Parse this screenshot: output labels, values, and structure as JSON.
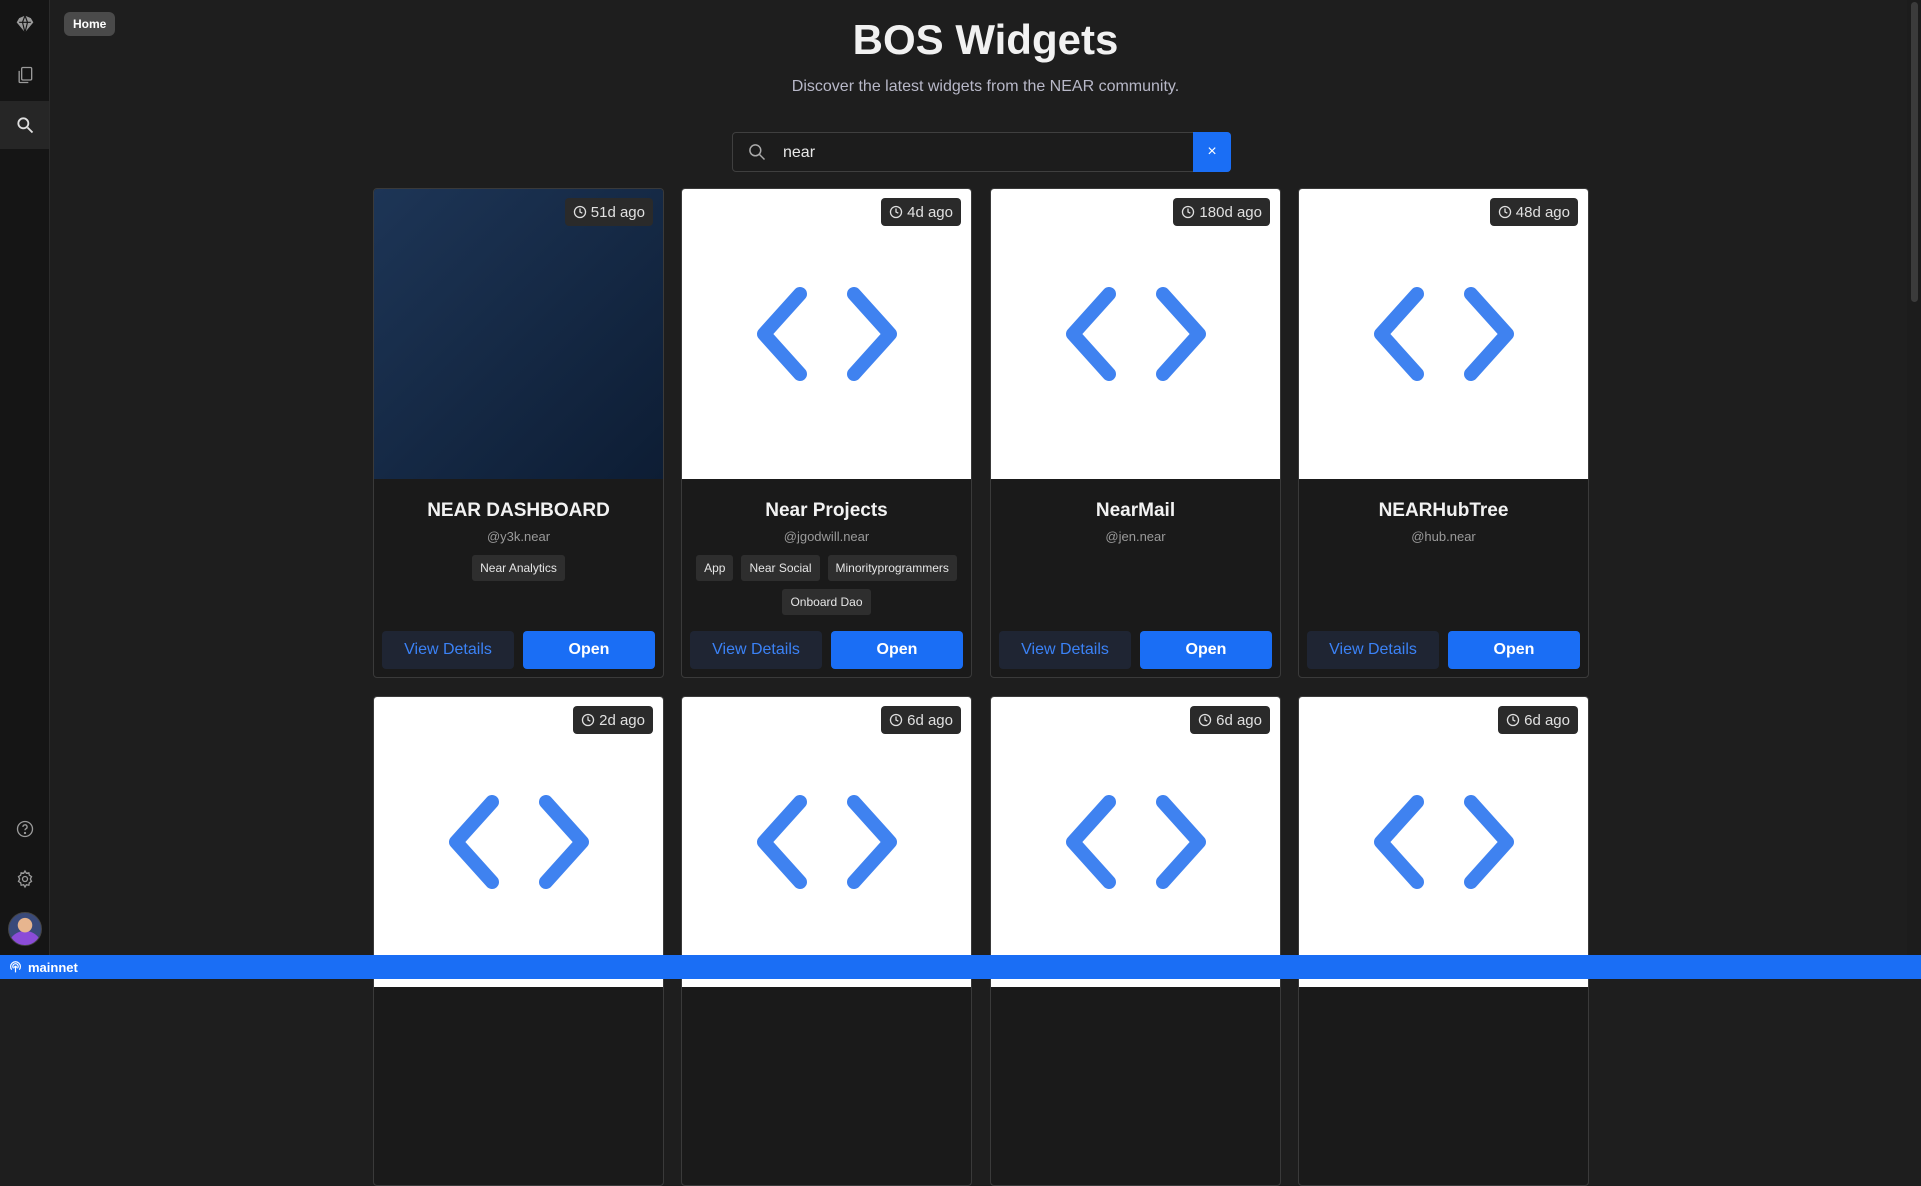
{
  "tooltip": {
    "home": "Home"
  },
  "header": {
    "title": "BOS Widgets",
    "subtitle": "Discover the latest widgets from the NEAR community."
  },
  "search": {
    "value": "near",
    "clear_label": "×"
  },
  "sidebar": {
    "icons": [
      "near-logo-icon",
      "copy-icon",
      "search-icon",
      "help-icon",
      "settings-icon",
      "avatar"
    ]
  },
  "buttons": {
    "details": "View Details",
    "open": "Open"
  },
  "widgets": [
    {
      "name": "NEAR DASHBOARD",
      "author": "@y3k.near",
      "age": "51d ago",
      "tags": [
        "Near Analytics"
      ],
      "thumb": "dashboard"
    },
    {
      "name": "Near Projects",
      "author": "@jgodwill.near",
      "age": "4d ago",
      "tags": [
        "App",
        "Near Social",
        "Minorityprogrammers",
        "Onboard Dao"
      ],
      "thumb": "code"
    },
    {
      "name": "NearMail",
      "author": "@jen.near",
      "age": "180d ago",
      "tags": [],
      "thumb": "code"
    },
    {
      "name": "NEARHubTree",
      "author": "@hub.near",
      "age": "48d ago",
      "tags": [],
      "thumb": "code"
    },
    {
      "name": "",
      "author": "",
      "age": "2d ago",
      "tags": [],
      "thumb": "code"
    },
    {
      "name": "",
      "author": "",
      "age": "6d ago",
      "tags": [],
      "thumb": "code"
    },
    {
      "name": "",
      "author": "",
      "age": "6d ago",
      "tags": [],
      "thumb": "code"
    },
    {
      "name": "",
      "author": "",
      "age": "6d ago",
      "tags": [],
      "thumb": "code"
    }
  ],
  "statusbar": {
    "network": "mainnet"
  },
  "colors": {
    "accent": "#1a6ef5",
    "code_icon": "#3f82f0",
    "background": "#1e1e1e"
  }
}
